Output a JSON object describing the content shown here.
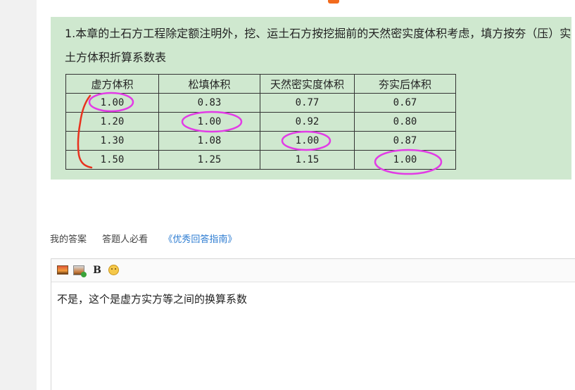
{
  "question": {
    "line1": "1.本章的土石方工程除定额注明外，挖、运土石方按挖掘前的天然密实度体积考虑，填方按夯（压）实",
    "line2": "土方体积折算系数表",
    "table": {
      "headers": [
        "虚方体积",
        "松填体积",
        "天然密实度体积",
        "夯实后体积"
      ],
      "rows": [
        [
          "1.00",
          "0.83",
          "0.77",
          "0.67"
        ],
        [
          "1.20",
          "1.00",
          "0.92",
          "0.80"
        ],
        [
          "1.30",
          "1.08",
          "1.00",
          "0.87"
        ],
        [
          "1.50",
          "1.25",
          "1.15",
          "1.00"
        ]
      ]
    },
    "annotation_colors": {
      "circle": "#e23be6",
      "bracket": "#e8321e"
    }
  },
  "answer_bar": {
    "my_answer": "我的答案",
    "must_read": "答题人必看",
    "guide_link": "《优秀回答指南》"
  },
  "editor": {
    "toolbar": {
      "image_icon": "image-icon",
      "insert_image_icon": "insert-image-icon",
      "bold_label": "B",
      "emoji_icon": "emoji-icon"
    },
    "content": "不是，这个是虚方实方等之间的换算系数"
  }
}
